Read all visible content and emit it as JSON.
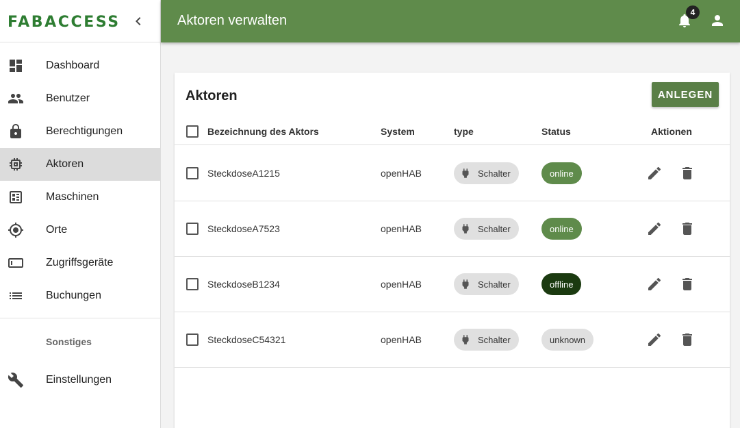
{
  "brand": {
    "logo_text": "FABACCESS"
  },
  "sidebar": {
    "items": [
      {
        "label": "Dashboard",
        "icon": "dashboard-icon",
        "active": false
      },
      {
        "label": "Benutzer",
        "icon": "people-icon",
        "active": false
      },
      {
        "label": "Berechtigungen",
        "icon": "lock-icon",
        "active": false
      },
      {
        "label": "Aktoren",
        "icon": "chip-icon",
        "active": true
      },
      {
        "label": "Maschinen",
        "icon": "machine-icon",
        "active": false
      },
      {
        "label": "Orte",
        "icon": "location-icon",
        "active": false
      },
      {
        "label": "Zugriffsgeräte",
        "icon": "device-icon",
        "active": false
      },
      {
        "label": "Buchungen",
        "icon": "list-icon",
        "active": false
      }
    ],
    "section_label": "Sonstiges",
    "extra_items": [
      {
        "label": "Einstellungen",
        "icon": "wrench-icon"
      }
    ]
  },
  "header": {
    "title": "Aktoren verwalten",
    "notification_count": "4"
  },
  "card": {
    "title": "Aktoren",
    "create_button": "Anlegen",
    "columns": {
      "name": "Bezeichnung des Aktors",
      "system": "System",
      "type": "type",
      "status": "Status",
      "actions": "Aktionen"
    },
    "rows": [
      {
        "name": "SteckdoseA1215",
        "system": "openHAB",
        "type": "Schalter",
        "status": "online"
      },
      {
        "name": "SteckdoseA7523",
        "system": "openHAB",
        "type": "Schalter",
        "status": "online"
      },
      {
        "name": "SteckdoseB1234",
        "system": "openHAB",
        "type": "Schalter",
        "status": "offline"
      },
      {
        "name": "SteckdoseC54321",
        "system": "openHAB",
        "type": "Schalter",
        "status": "unknown"
      }
    ]
  },
  "colors": {
    "primary": "#5f8b4b",
    "button": "#5a7f47",
    "status_online": "#5f8b4b",
    "status_offline": "#1b3a10",
    "status_unknown": "#e0e0e0"
  }
}
